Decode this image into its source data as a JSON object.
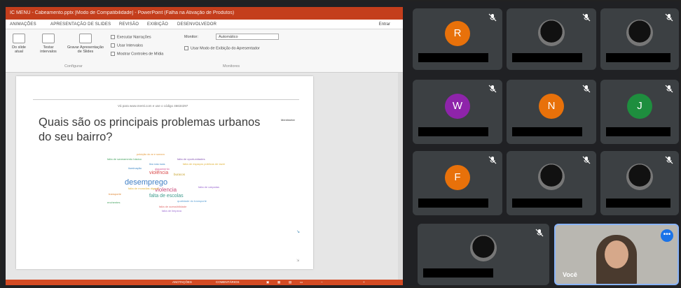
{
  "ppt": {
    "title": "IC MENU - Cabeamento.pptx [Modo de Compatibilidade] - PowerPoint (Falha na Ativação de Produtos)",
    "tabs": [
      "ANIMAÇÕES",
      "APRESENTAÇÃO DE SLIDES",
      "REVISÃO",
      "EXIBIÇÃO",
      "DESENVOLVEDOR"
    ],
    "share_label": "Entrar",
    "ribbon": {
      "btn_from_slide": "Do slide atual",
      "btn_rehearse": "Testar intervalos",
      "btn_record": "Gravar Apresentação de Slides",
      "chk_narrations": "Executar Narrações",
      "chk_timings": "Usar Intervalos",
      "chk_controls": "Mostrar Controles de Mídia",
      "group_config": "Configurar",
      "monitor_label": "Monitor:",
      "monitor_value": "Automático",
      "presenter_view": "Usar Modo de Exibição do Apresentador",
      "group_monitors": "Monitores"
    },
    "status": {
      "notes": "ANOTAÇÕES",
      "comments": "COMENTÁRIOS"
    }
  },
  "slide": {
    "url": "Vá para www.menti.com e use o código 46634297",
    "logo": "Mentimeter",
    "question": "Quais são os principais problemas urbanos do seu bairro?",
    "wordcloud": [
      {
        "text": "poluição do ar e sonora",
        "color": "#e59a3a"
      },
      {
        "text": "falta de saneamento básico",
        "color": "#4aa564"
      },
      {
        "text": "falta de oportunidades",
        "color": "#8a5bb5"
      },
      {
        "text": "lixo nas ruas",
        "color": "#3f88c5"
      },
      {
        "text": "falta de espaços públicos de lazer",
        "color": "#e0b33a"
      },
      {
        "text": "iluminação",
        "color": "#3f88c5"
      },
      {
        "text": "alagamento",
        "color": "#d45b9a"
      },
      {
        "text": "violência",
        "color": "#d94c4c"
      },
      {
        "text": "buracos",
        "color": "#c7a12a"
      },
      {
        "text": "desemprego",
        "color": "#3f7fc5"
      },
      {
        "text": "violencia",
        "color": "#c94b7a"
      },
      {
        "text": "falta de moradias dignas",
        "color": "#e0b33a"
      },
      {
        "text": "falta de calçadas",
        "color": "#9c6bd1"
      },
      {
        "text": "falta de escolas",
        "color": "#3d9a8c"
      },
      {
        "text": "transporte",
        "color": "#e08a3a"
      },
      {
        "text": "qualidade do transporte",
        "color": "#5a9fd4"
      },
      {
        "text": "enchentes",
        "color": "#4aa564"
      },
      {
        "text": "falta de acessibilidade",
        "color": "#e06a6a"
      },
      {
        "text": "falta de limpeza",
        "color": "#9c6bd1"
      }
    ],
    "mark_a": "↘",
    "mark_b": "⇲"
  },
  "meet": {
    "participants": [
      {
        "initial": "R",
        "color": "#e8710a"
      },
      {
        "initial": "",
        "color": ""
      },
      {
        "initial": "",
        "color": ""
      },
      {
        "initial": "W",
        "color": "#8e24aa"
      },
      {
        "initial": "N",
        "color": "#e8710a"
      },
      {
        "initial": "J",
        "color": "#1e8e3e"
      },
      {
        "initial": "F",
        "color": "#e8710a"
      },
      {
        "initial": "",
        "color": ""
      },
      {
        "initial": "",
        "color": ""
      },
      {
        "initial": "",
        "color": ""
      }
    ],
    "self_label": "Você",
    "more_icon": "•••"
  }
}
